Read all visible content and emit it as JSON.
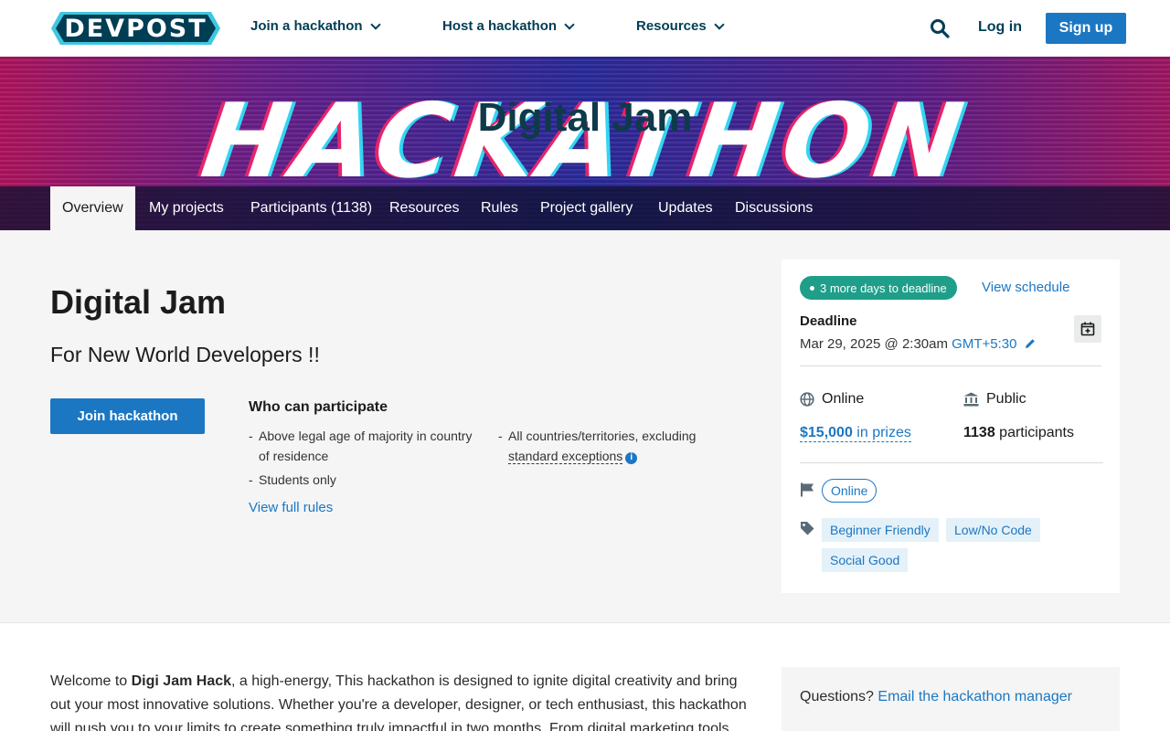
{
  "brand": {
    "logo_text": "DEVPOST",
    "accent": "#1c77c3",
    "logo_color": "#003e54",
    "logo_edge": "#40c7e0"
  },
  "nav": {
    "items": [
      {
        "label": "Join a hackathon"
      },
      {
        "label": "Host a hackathon"
      },
      {
        "label": "Resources"
      }
    ],
    "search_icon": "search-icon",
    "login_label": "Log in",
    "signup_label": "Sign up"
  },
  "banner": {
    "art_text": "HACKATHON",
    "title": "Digital Jam"
  },
  "tabs": [
    {
      "label": "Overview",
      "active": true
    },
    {
      "label": "My projects"
    },
    {
      "label": "Participants (1138)"
    },
    {
      "label": "Resources"
    },
    {
      "label": "Rules"
    },
    {
      "label": "Project gallery"
    },
    {
      "label": "Updates"
    },
    {
      "label": "Discussions"
    }
  ],
  "main": {
    "title": "Digital Jam",
    "tagline": "For New World Developers !!",
    "join_label": "Join hackathon",
    "who_title": "Who can participate",
    "eligibility": [
      "Above legal age of majority in country of residence",
      "Students only",
      "All countries/territories, excluding"
    ],
    "standard_exceptions": "standard exceptions",
    "view_rules": "View full rules"
  },
  "sidebar": {
    "badge": "3 more days to deadline",
    "view_schedule": "View schedule",
    "deadline_label": "Deadline",
    "deadline_value": "Mar 29, 2025 @ 2:30am",
    "timezone": "GMT+5:30",
    "location": "Online",
    "visibility": "Public",
    "prize_amount": "$15,000",
    "prize_suffix": "in prizes",
    "participant_count": "1138",
    "participant_suffix": "participants",
    "format_pill": "Online",
    "themes": [
      "Beginner Friendly",
      "Low/No Code",
      "Social Good"
    ],
    "badge_color": "#1f9e89"
  },
  "lower": {
    "intro_prefix": "Welcome to ",
    "intro_bold": "Digi Jam Hack",
    "intro_rest": ", a high-energy, This hackathon is designed to ignite digital creativity and bring out your most innovative solutions. Whether you're a developer, designer, or tech enthusiast, this hackathon will push you to your limits to create something truly impactful in two months. From digital marketing tools",
    "questions_label": "Questions?",
    "questions_link": "Email the hackathon manager"
  }
}
